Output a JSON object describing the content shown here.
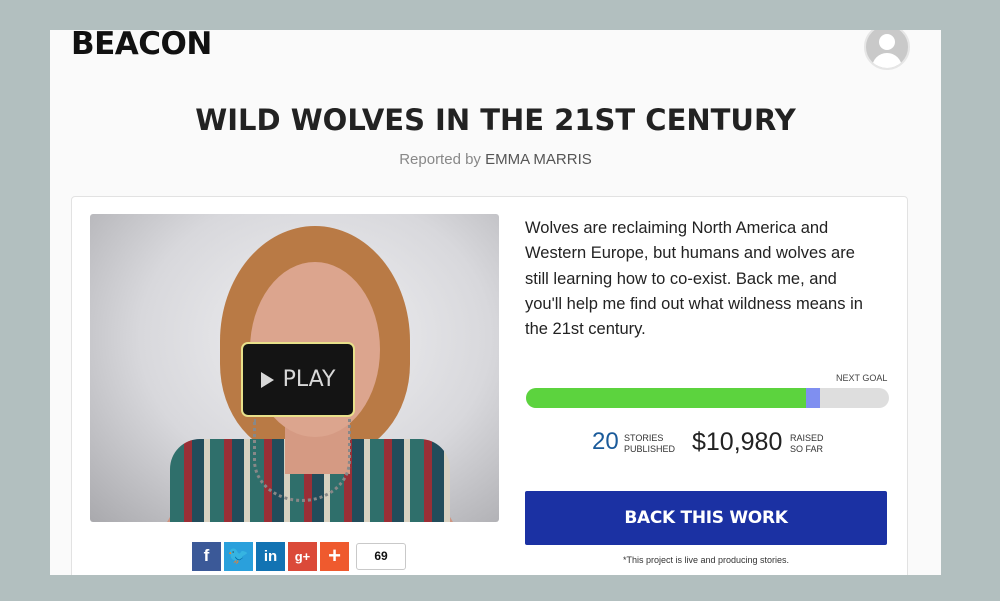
{
  "header": {
    "brand": "BEACON",
    "avatar_icon": "user-avatar-icon"
  },
  "project": {
    "title": "WILD WOLVES IN THE 21ST CENTURY",
    "reported_by_prefix": "Reported by",
    "author": "EMMA MARRIS",
    "description": "Wolves are reclaiming North America and Western Europe, but humans and wolves are still learning how to co-exist. Back me, and you'll help me find out what wildness means in the 21st century."
  },
  "video": {
    "play_label": "PLAY"
  },
  "progress": {
    "next_goal_label": "NEXT GOAL",
    "fraction": 0.77,
    "colors": {
      "fill": "#5cd33e",
      "marker": "#7f8ff0",
      "track": "#dedede"
    }
  },
  "stats": {
    "stories_count": "20",
    "stories_label_1": "STORIES",
    "stories_label_2": "PUBLISHED",
    "raised_amount": "$10,980",
    "raised_label_1": "RAISED",
    "raised_label_2": "SO FAR",
    "colors": {
      "stories": "#1a5a9a",
      "raised": "#222222"
    }
  },
  "cta": {
    "label": "BACK THIS WORK",
    "color": "#1b31a3"
  },
  "note": "*This project is live and producing stories.",
  "share": {
    "buttons": [
      {
        "icon": "facebook-icon",
        "glyph": "f"
      },
      {
        "icon": "twitter-icon",
        "glyph": "🐦"
      },
      {
        "icon": "linkedin-icon",
        "glyph": "in"
      },
      {
        "icon": "google-plus-icon",
        "glyph": "g+"
      },
      {
        "icon": "more-share-icon",
        "glyph": "+"
      }
    ],
    "count": "69"
  }
}
